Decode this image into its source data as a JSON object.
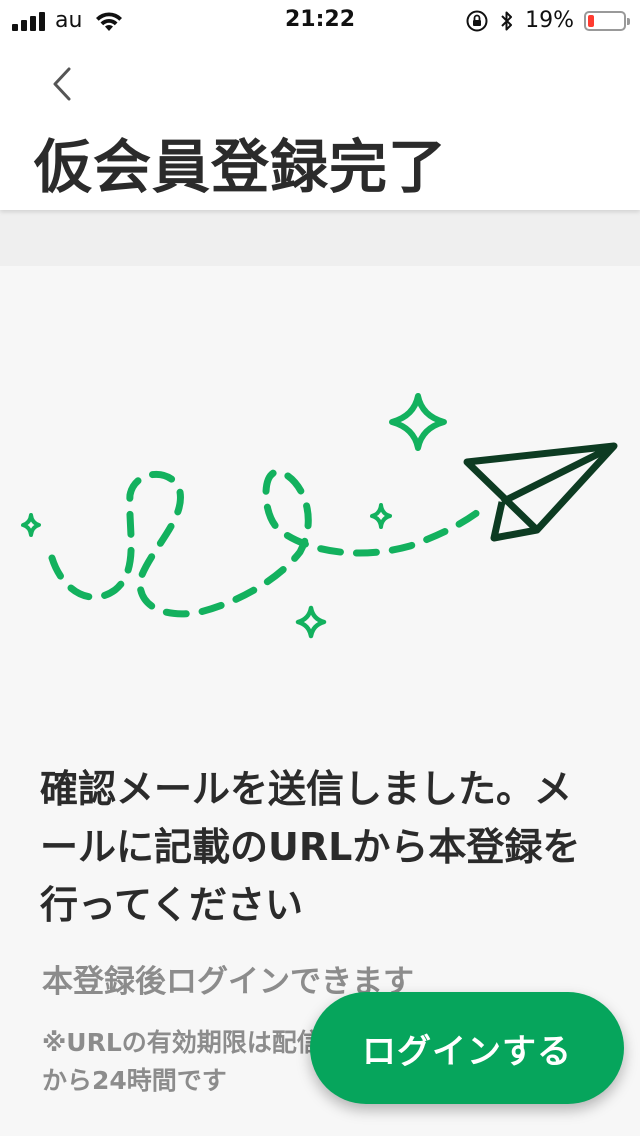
{
  "status_bar": {
    "carrier": "au",
    "time": "21:22",
    "battery_percent": "19%",
    "battery_level": 0.19,
    "battery_color": "#ff3b30",
    "icons": [
      "signal-icon",
      "wifi-icon",
      "orientation-lock-icon",
      "bluetooth-icon",
      "battery-icon"
    ]
  },
  "header": {
    "back_icon": "chevron-left-icon",
    "title": "仮会員登録完了"
  },
  "illustration": {
    "icons": [
      "paper-plane-icon",
      "sparkle-icon"
    ],
    "colors": {
      "path": "#13b15e",
      "plane": "#0d3b22"
    }
  },
  "main": {
    "headline": "確認メールを送信しました。メールに記載のURLから本登録を行ってください",
    "sub_text": "本登録後ログインできます",
    "note": "※URLの有効期限は配信から24時間です"
  },
  "login_button": {
    "label": "ログインする",
    "color": "#06a55c"
  }
}
